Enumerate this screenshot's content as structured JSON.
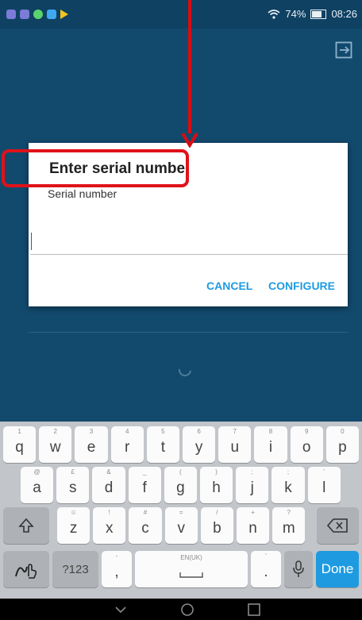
{
  "status_bar": {
    "wifi_icon": "wifi-icon",
    "battery_text": "74%",
    "time": "08:26"
  },
  "dialog": {
    "title": "Enter serial numbe",
    "field_label": "Serial number",
    "input_value": "",
    "cancel_label": "CANCEL",
    "configure_label": "CONFIGURE"
  },
  "colors": {
    "app_background": "#124a6e",
    "accent": "#1e9be0",
    "annotation": "#e0121a"
  },
  "keyboard": {
    "row1": [
      {
        "key": "q",
        "hint": "1"
      },
      {
        "key": "w",
        "hint": "2"
      },
      {
        "key": "e",
        "hint": "3"
      },
      {
        "key": "r",
        "hint": "4"
      },
      {
        "key": "t",
        "hint": "5"
      },
      {
        "key": "y",
        "hint": "6"
      },
      {
        "key": "u",
        "hint": "7"
      },
      {
        "key": "i",
        "hint": "8"
      },
      {
        "key": "o",
        "hint": "9"
      },
      {
        "key": "p",
        "hint": "0"
      }
    ],
    "row2": [
      {
        "key": "a",
        "hint": "@"
      },
      {
        "key": "s",
        "hint": "£"
      },
      {
        "key": "d",
        "hint": "&"
      },
      {
        "key": "f",
        "hint": "_"
      },
      {
        "key": "g",
        "hint": "("
      },
      {
        "key": "h",
        "hint": ")"
      },
      {
        "key": "j",
        "hint": ";"
      },
      {
        "key": "k",
        "hint": ";"
      },
      {
        "key": "l",
        "hint": "'"
      }
    ],
    "row3": [
      {
        "key": "z",
        "hint": "☺"
      },
      {
        "key": "x",
        "hint": "!"
      },
      {
        "key": "c",
        "hint": "#"
      },
      {
        "key": "v",
        "hint": "="
      },
      {
        "key": "b",
        "hint": "/"
      },
      {
        "key": "n",
        "hint": "+"
      },
      {
        "key": "m",
        "hint": "?"
      }
    ],
    "symbols_label": "?123",
    "comma": ",",
    "comma_hint": "-",
    "space_label": "EN(UK)",
    "period": ".",
    "period_hint": "'",
    "done_label": "Done"
  }
}
